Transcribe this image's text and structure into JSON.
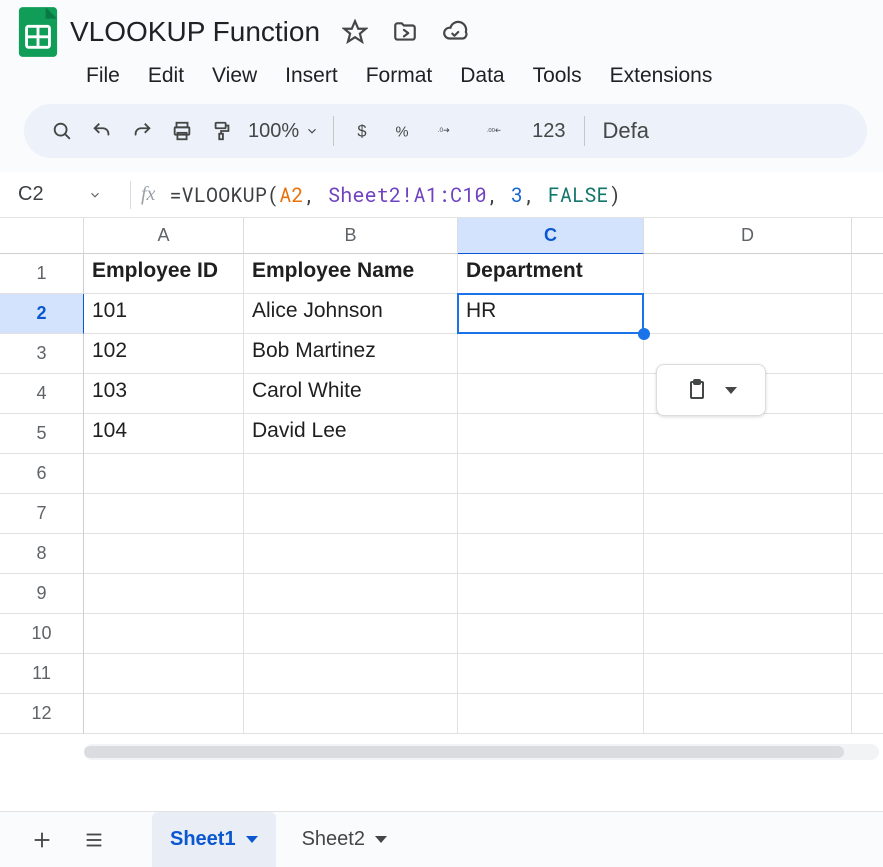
{
  "doc": {
    "title": "VLOOKUP Function"
  },
  "menu": {
    "items": [
      "File",
      "Edit",
      "View",
      "Insert",
      "Format",
      "Data",
      "Tools",
      "Extensions"
    ]
  },
  "toolbar": {
    "zoom": "100%",
    "tail": "Defa"
  },
  "namebox": {
    "cell": "C2"
  },
  "formula": {
    "fn_open": "=VLOOKUP(",
    "arg1": "A2",
    "comma": ", ",
    "arg2": "Sheet2!A1:C10",
    "arg3": "3",
    "arg4": "FALSE",
    "close": ")"
  },
  "columns": [
    "A",
    "B",
    "C",
    "D",
    ""
  ],
  "selected_col_index": 2,
  "row_numbers": [
    "1",
    "2",
    "3",
    "4",
    "5",
    "6",
    "7",
    "8",
    "9",
    "10",
    "11",
    "12"
  ],
  "selected_row_index": 1,
  "table": {
    "headers": {
      "A": "Employee ID",
      "B": "Employee Name",
      "C": "Department"
    },
    "rows": [
      {
        "A": "101",
        "B": "Alice Johnson",
        "C": "HR"
      },
      {
        "A": "102",
        "B": "Bob Martinez",
        "C": ""
      },
      {
        "A": "103",
        "B": "Carol White",
        "C": ""
      },
      {
        "A": "104",
        "B": "David Lee",
        "C": ""
      }
    ]
  },
  "tabs": {
    "sheets": [
      "Sheet1",
      "Sheet2"
    ],
    "active_index": 0
  }
}
